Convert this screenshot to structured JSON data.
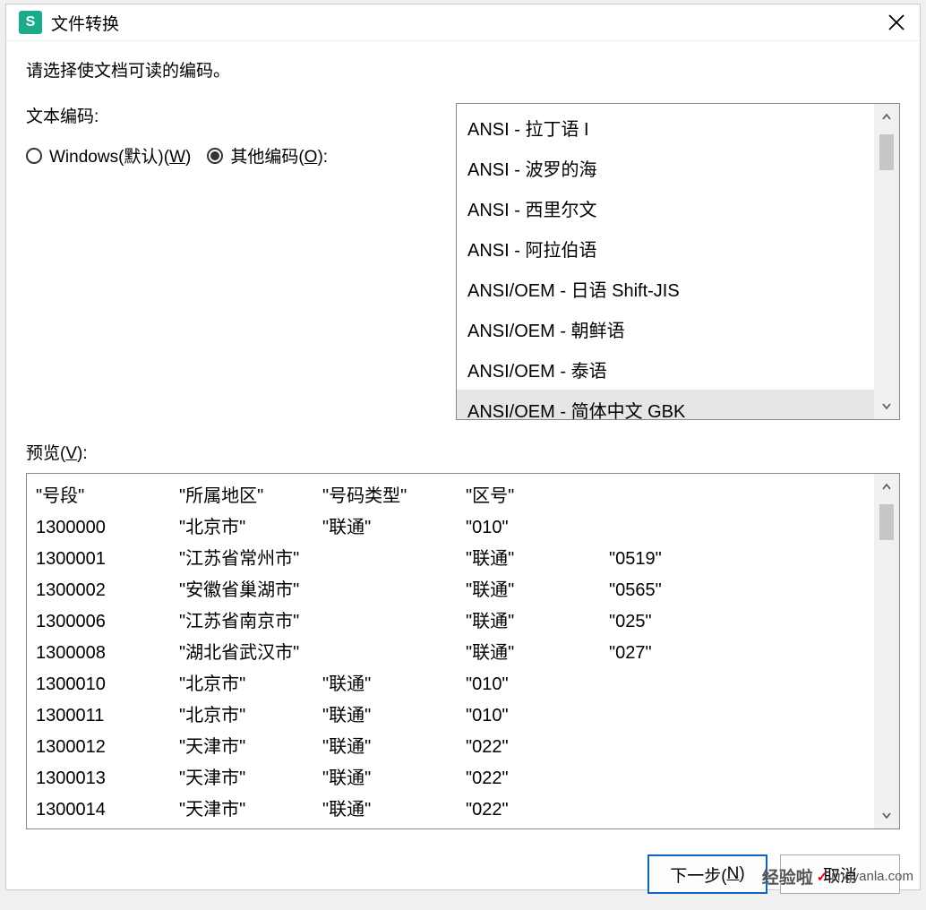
{
  "titlebar": {
    "app_icon_letter": "S",
    "title": "文件转换"
  },
  "prompt": "请选择使文档可读的编码。",
  "encoding": {
    "label": "文本编码:",
    "radio_windows": "Windows(默认)(",
    "radio_windows_key": "W",
    "radio_windows_tail": ")",
    "radio_other": "其他编码(",
    "radio_other_key": "O",
    "radio_other_tail": "):",
    "selected": "other"
  },
  "encoding_list": [
    "ANSI - 拉丁语 I",
    "ANSI - 波罗的海",
    "ANSI - 西里尔文",
    "ANSI - 阿拉伯语",
    "ANSI/OEM - 日语 Shift-JIS",
    "ANSI/OEM - 朝鲜语",
    "ANSI/OEM - 泰语",
    "ANSI/OEM - 简体中文 GBK"
  ],
  "encoding_selected_index": 7,
  "preview_label_pre": "预览(",
  "preview_label_key": "V",
  "preview_label_tail": "):",
  "preview_rows": [
    [
      "\"号段\"",
      "\"所属地区\"",
      "\"号码类型\"",
      "\"区号\"",
      ""
    ],
    [
      "1300000",
      "\"北京市\"",
      "\"联通\"",
      "\"010\"",
      ""
    ],
    [
      "1300001",
      "\"江苏省常州市\"",
      "",
      "\"联通\"",
      "\"0519\""
    ],
    [
      "1300002",
      "\"安徽省巢湖市\"",
      "",
      "\"联通\"",
      "\"0565\""
    ],
    [
      "1300006",
      "\"江苏省南京市\"",
      "",
      "\"联通\"",
      "\"025\""
    ],
    [
      "1300008",
      "\"湖北省武汉市\"",
      "",
      "\"联通\"",
      "\"027\""
    ],
    [
      "1300010",
      "\"北京市\"",
      "\"联通\"",
      "\"010\"",
      ""
    ],
    [
      "1300011",
      "\"北京市\"",
      "\"联通\"",
      "\"010\"",
      ""
    ],
    [
      "1300012",
      "\"天津市\"",
      "\"联通\"",
      "\"022\"",
      ""
    ],
    [
      "1300013",
      "\"天津市\"",
      "\"联通\"",
      "\"022\"",
      ""
    ],
    [
      "1300014",
      "\"天津市\"",
      "\"联通\"",
      "\"022\"",
      ""
    ]
  ],
  "footer": {
    "next": "下一步(",
    "next_key": "N",
    "next_tail": ")",
    "cancel": "取消"
  },
  "watermark": {
    "text_big": "经验啦",
    "text_small": "jingyanla.com"
  }
}
